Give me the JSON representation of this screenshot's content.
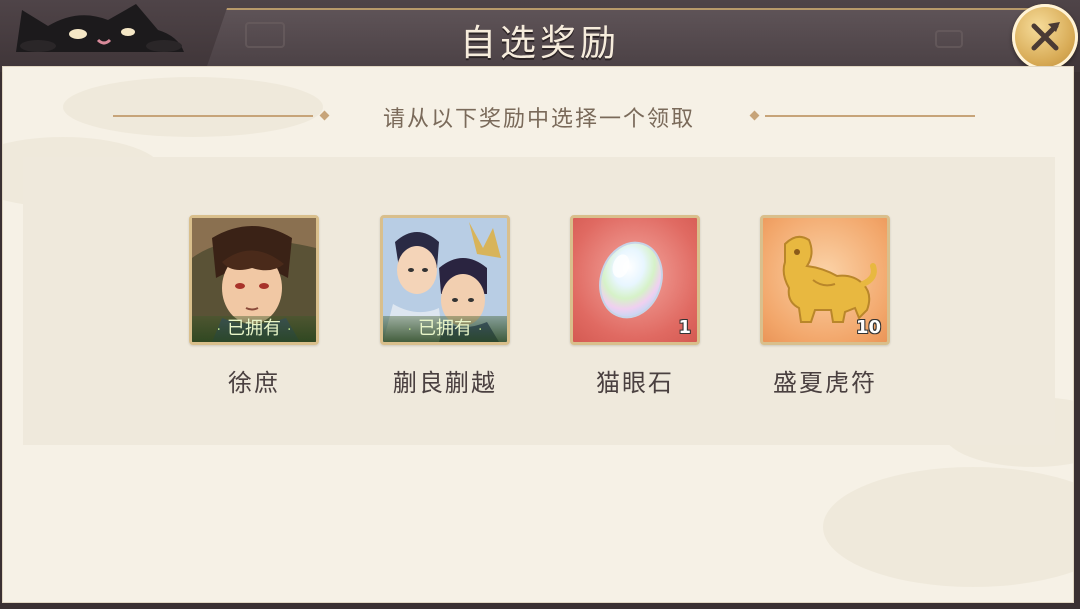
{
  "dialog": {
    "title": "自选奖励",
    "subtitle": "请从以下奖励中选择一个领取",
    "close_icon": "close-x-icon"
  },
  "rewards": [
    {
      "name": "徐庶",
      "badge": "已拥有",
      "count": null,
      "icon": "hero-xu-shu-portrait",
      "frame_color": "#5b7a3c"
    },
    {
      "name": "蒯良蒯越",
      "badge": "已拥有",
      "count": null,
      "icon": "hero-kuai-brothers-portrait",
      "frame_color": "#4a6a9a"
    },
    {
      "name": "猫眼石",
      "badge": null,
      "count": "1",
      "icon": "cats-eye-gem-icon",
      "frame_color": "#e66e68"
    },
    {
      "name": "盛夏虎符",
      "badge": null,
      "count": "10",
      "icon": "golden-tiger-tally-icon",
      "frame_color": "#f2a66a"
    }
  ],
  "colors": {
    "title_bar": "#4a4044",
    "panel_bg": "#f6f1e6",
    "accent_gold": "#d8ab56",
    "owned_text": "#e8f5c8"
  }
}
